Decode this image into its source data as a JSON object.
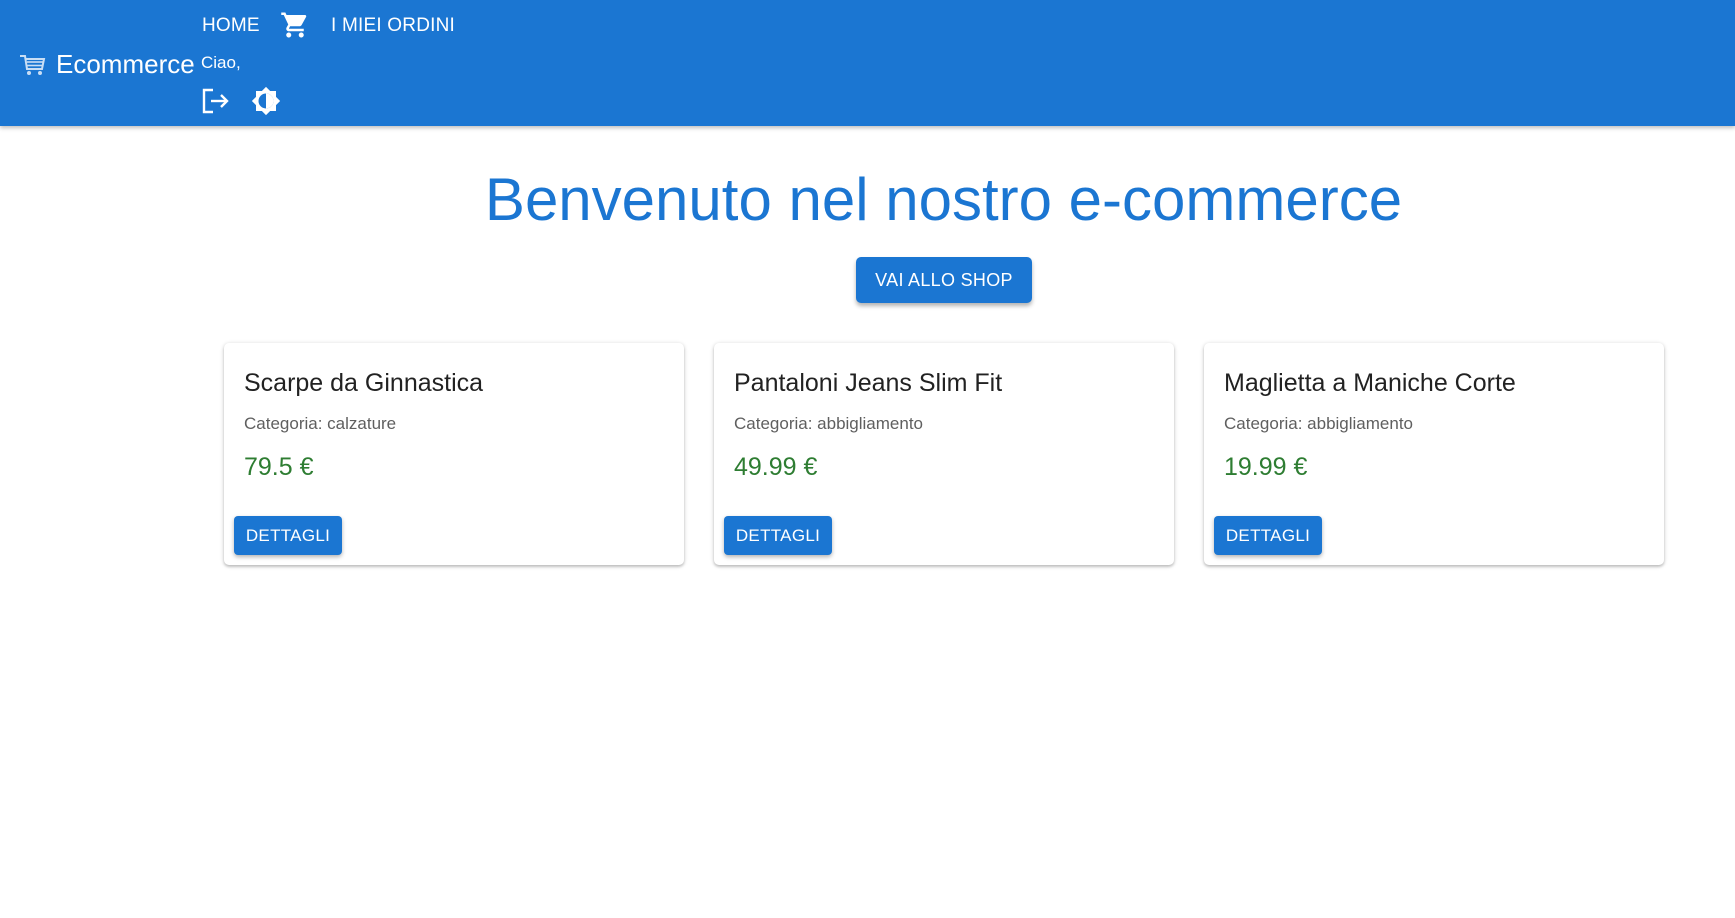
{
  "header": {
    "brand_icon": "shopping-basket-icon",
    "brand_title": "Ecommerce",
    "nav": {
      "home_label": "HOME",
      "cart_icon": "shopping-cart-icon",
      "orders_label": "I MIEI ORDINI"
    },
    "greeting": "Ciao,",
    "logout_icon": "logout-icon",
    "theme_icon": "brightness-icon",
    "background_color": "#1b76d2"
  },
  "hero": {
    "title": "Benvenuto nel nostro e-commerce",
    "shop_button_label": "VAI ALLO SHOP"
  },
  "products": [
    {
      "name": "Scarpe da Ginnastica",
      "category": "Categoria: calzature",
      "price": "79.5 €",
      "button_label": "DETTAGLI"
    },
    {
      "name": "Pantaloni Jeans Slim Fit",
      "category": "Categoria: abbigliamento",
      "price": "49.99 €",
      "button_label": "DETTAGLI"
    },
    {
      "name": "Maglietta a Maniche Corte",
      "category": "Categoria: abbigliamento",
      "price": "19.99 €",
      "button_label": "DETTAGLI"
    }
  ],
  "colors": {
    "primary": "#1b76d2",
    "price": "#2e7d32"
  }
}
